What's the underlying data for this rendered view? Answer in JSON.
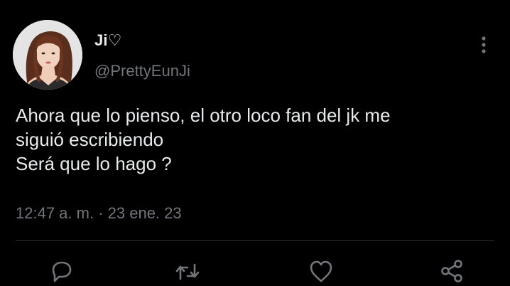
{
  "author": {
    "display_name": "Ji♡",
    "handle": "@PrettyEunJi"
  },
  "tweet": {
    "lines": [
      "Ahora que lo pienso, el otro loco fan del jk me",
      "siguió escribiendo",
      "Será que lo hago ?"
    ]
  },
  "meta": {
    "time": "12:47 a. m.",
    "separator": " · ",
    "date": "23 ene. 23"
  },
  "icons": {
    "more": "more-vertical-icon",
    "reply": "reply-icon",
    "retweet": "retweet-icon",
    "like": "heart-icon",
    "share": "share-icon"
  },
  "colors": {
    "background": "#000000",
    "text": "#e7e9ea",
    "secondary": "#71767b",
    "divider": "#2f3336"
  }
}
